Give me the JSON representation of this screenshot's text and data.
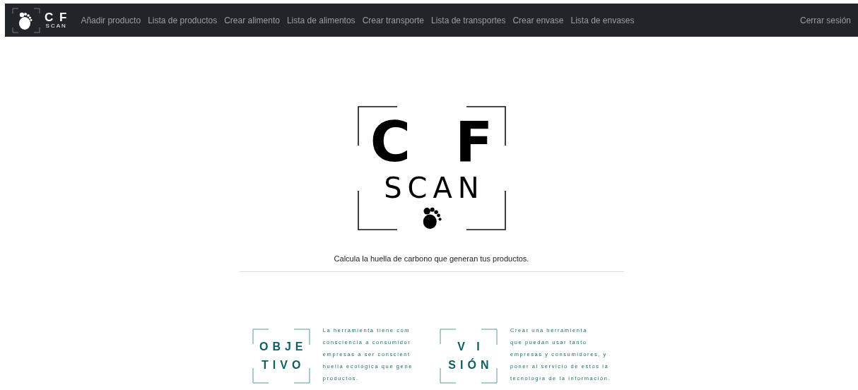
{
  "navbar": {
    "brand": {
      "title": "C F",
      "subtitle": "SCAN"
    },
    "links": [
      {
        "label": "Añadir producto"
      },
      {
        "label": "Lista de productos"
      },
      {
        "label": "Crear alimento"
      },
      {
        "label": "Lista de alimentos"
      },
      {
        "label": "Crear transporte"
      },
      {
        "label": "Lista de transportes"
      },
      {
        "label": "Crear envase"
      },
      {
        "label": "Lista de envases"
      }
    ],
    "logout": "Cerrar sesión"
  },
  "hero": {
    "logo_title": "C F",
    "logo_subtitle": "SCAN",
    "tagline": "Calcula la huella de carbono que generan tus productos."
  },
  "sections": [
    {
      "heading_lines": [
        "OBJE",
        "TIVO"
      ],
      "text_lines": [
        "La herramienta tiene com",
        "consciencia a consumidor",
        "empresas a ser conscient",
        "huella ecológica que gene",
        "productos."
      ]
    },
    {
      "heading_lines": [
        "V I",
        "SIÓN"
      ],
      "text_lines": [
        "Crear una herramienta",
        "que puedan usar tanto",
        "empresas y consumidores, y",
        "poner al servicio de estos la",
        "tecnología de la información."
      ]
    }
  ]
}
